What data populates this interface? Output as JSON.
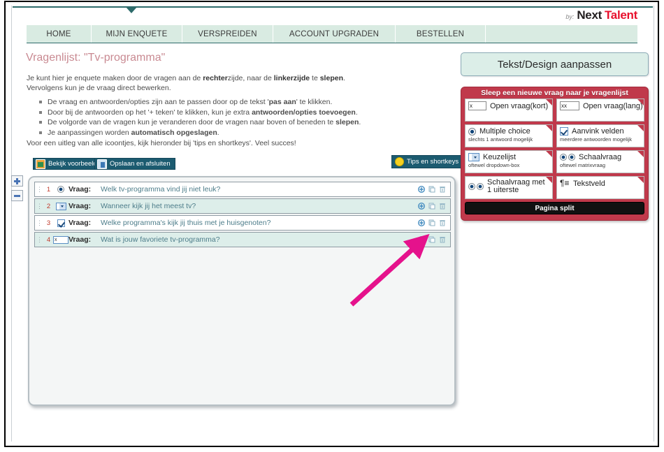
{
  "brand": {
    "by": "by:",
    "name_dark": "Next",
    "name_red": "Talent",
    "red": "#e8112d"
  },
  "nav": {
    "items": [
      {
        "label": "HOME",
        "name": "home"
      },
      {
        "label": "MIJN ENQUETE",
        "name": "mijn-enquete"
      },
      {
        "label": "VERSPREIDEN",
        "name": "verspreiden"
      },
      {
        "label": "ACCOUNT UPGRADEN",
        "name": "account-upgraden"
      },
      {
        "label": "BESTELLEN",
        "name": "bestellen"
      }
    ],
    "bg": "#d9ebe2",
    "rule": "#2d6b6b"
  },
  "content": {
    "title": "Vragenlijst: \"Tv-programma\"",
    "title_color": "#c98a92",
    "intro_line1_a": "Je kunt hier je enquete maken door de vragen aan de ",
    "intro_line1_b": "rechter",
    "intro_line1_c": "zijde, naar de ",
    "intro_line1_d": "linkerzijde",
    "intro_line1_e": " te ",
    "intro_line1_f": "slepen",
    "intro_line1_g": ".",
    "intro_line2": "Vervolgens kun je de vraag direct bewerken.",
    "bullets": [
      {
        "pre": "De vraag en antwoorden/opties zijn aan te passen door op de tekst '",
        "strong": "pas aan",
        "post": "' te klikken."
      },
      {
        "pre": "Door bij de antwoorden op het '+ teken' te klikken, kun je extra ",
        "strong": "antwoorden/opties toevoegen",
        "post": "."
      },
      {
        "pre": "De volgorde van de vragen kun je veranderen door de vragen naar boven of beneden te ",
        "strong": "slepen",
        "post": "."
      },
      {
        "pre": "Je aanpassingen worden ",
        "strong": "automatisch opgeslagen",
        "post": "."
      }
    ],
    "outro": "Voor een uitleg van alle icoontjes, kijk hieronder bij 'tips en shortkeys'. Veel succes!"
  },
  "toolbar": {
    "preview_label": "Bekijk voorbeeld",
    "save_label": "Opslaan en afsluiten",
    "tips_label": "Tips en shortkeys",
    "bg": "#1c5b70"
  },
  "zoom_controls": {
    "plus": "+",
    "minus": "-"
  },
  "questions": {
    "label": "Vraag:",
    "rows": [
      {
        "num": "1",
        "type": "radio",
        "text": "Welk tv-programma vind jij niet leuk?",
        "alt": false
      },
      {
        "num": "2",
        "type": "dropdown",
        "text": "Wanneer kijk jij het meest tv?",
        "alt": true
      },
      {
        "num": "3",
        "type": "checkbox",
        "text": "Welke programma's kijk jij thuis met je huisgenoten?",
        "alt": false
      },
      {
        "num": "4",
        "type": "textinput",
        "text": "Wat is jouw favoriete tv-programma?",
        "alt": true,
        "textinput_value": "x"
      }
    ],
    "action_icons": [
      "add-icon",
      "duplicate-icon",
      "delete-icon"
    ],
    "text_color": "#4d7d8a",
    "num_color": "#c0392b"
  },
  "right_panel": {
    "design_button": "Tekst/Design aanpassen",
    "palette_title": "Sleep een nieuwe vraag naar je vragenlijst",
    "palette_bg": "#c0394b",
    "tiles": [
      {
        "title": "Open vraag(kort)",
        "sub": "",
        "glyph": "text-short-icon",
        "glyph_value": "x"
      },
      {
        "title": "Open vraag(lang)",
        "sub": "",
        "glyph": "text-long-icon",
        "glyph_value": "x"
      },
      {
        "title": "Multiple choice",
        "sub": "slechts 1 antwoord mogelijk",
        "glyph": "radio-icon"
      },
      {
        "title": "Aanvink velden",
        "sub": "meerdere antwoorden mogelijk",
        "glyph": "checkbox-icon"
      },
      {
        "title": "Keuzelijst",
        "sub": "oftewel dropdown-box",
        "glyph": "dropdown-icon"
      },
      {
        "title": "Schaalvraag",
        "sub": "oftewel matrixvraag",
        "glyph": "scale-icon"
      },
      {
        "title": "Schaalvraag met 1 uiterste",
        "sub": "",
        "glyph": "scale-one-end-icon"
      },
      {
        "title": "Tekstveld",
        "sub": "",
        "glyph": "paragraph-icon"
      }
    ],
    "page_split": "Pagina split"
  },
  "annotation": {
    "arrow_color": "#e5128c",
    "points_to": "add-icon-row-4"
  }
}
